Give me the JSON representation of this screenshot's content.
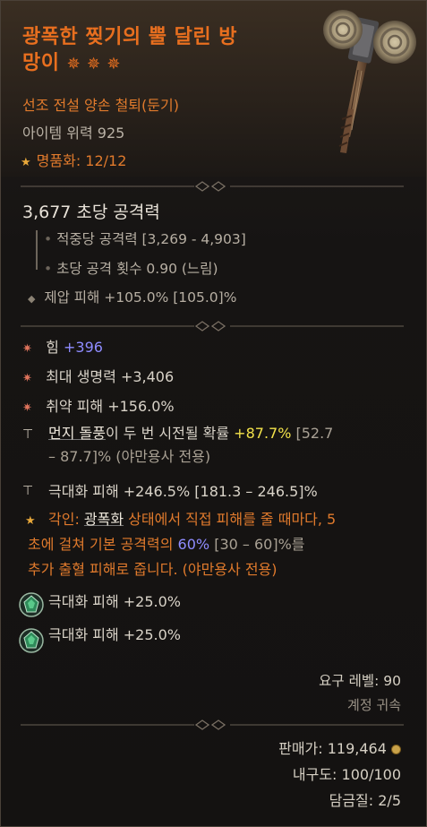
{
  "item": {
    "name_line1": "광폭한 찢기의 뿔 달린 방",
    "name_line2": "망이",
    "name_stars": "✵ ✵ ✵",
    "type": "선조 전설 양손 철퇴(둔기)",
    "power": "아이템 위력 925",
    "masterwork_label": "명품화: 12/12",
    "icon": "horned-mace-icon"
  },
  "weapon_stats": {
    "dps": "3,677 초당 공격력",
    "damage_per_hit": "적중당 공격력 [3,269 - 4,903]",
    "attack_speed": "초당 공격 횟수 0.90 (느림)",
    "overpower": "제압 피해 +105.0% [105.0]%"
  },
  "affixes": [
    {
      "label": "힘 ",
      "value": "+396",
      "icon": "affix-star-icon"
    },
    {
      "label": "최대 생명력 +3,406",
      "icon": "affix-star-icon"
    },
    {
      "label": "취약 피해 +156.0%",
      "icon": "affix-star-icon"
    }
  ],
  "tempered": [
    {
      "line1_a": "먼지 돌풍",
      "line1_b": "이 두 번 시전될 확률 ",
      "line1_c": "+87.7%",
      "line1_d": " [52.7",
      "line2": "– 87.7]% (야만용사 전용)",
      "icon": "anvil-icon"
    },
    {
      "label": "극대화 피해 +246.5% [181.3 – 246.5]%",
      "icon": "anvil-icon"
    }
  ],
  "aspect": {
    "prefix": "각인: ",
    "keyword": "광폭화",
    "line1_rest": " 상태에서 직접 피해를 줄 때마다, 5",
    "line2_a": "초에 걸쳐 기본 공격력의 ",
    "line2_b": "60%",
    "line2_c": " [30 – 60]%를",
    "line3": "추가 출혈 피해로 줍니다. (야만용사 전용)",
    "icon": "legendary-star-icon"
  },
  "gems": [
    {
      "label": "극대화 피해 +25.0%",
      "icon": "emerald-gem-icon"
    },
    {
      "label": "극대화 피해 +25.0%",
      "icon": "emerald-gem-icon"
    }
  ],
  "requirements": {
    "level": "요구 레벨: 90",
    "bound": "계정 귀속"
  },
  "footer": {
    "sell_label": "판매가: 119,464",
    "durability": "내구도: 100/100",
    "temper": "담금질: 2/5",
    "gold_icon": "gold-coin-icon"
  },
  "colors": {
    "legendary": "#e86f1f",
    "affix_blue": "#8f8cff",
    "highlight_yellow": "#f3e24a",
    "aspect_orange": "#e07a2c"
  }
}
